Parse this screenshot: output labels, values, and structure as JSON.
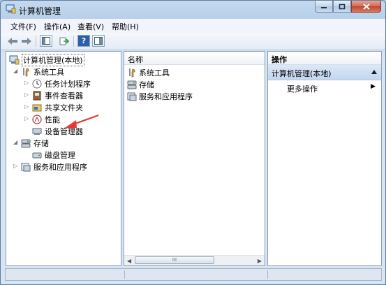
{
  "window": {
    "title": "计算机管理"
  },
  "menu": {
    "items": [
      "文件(F)",
      "操作(A)",
      "查看(V)",
      "帮助(H)"
    ]
  },
  "tree": {
    "root": "计算机管理(本地)",
    "items": [
      {
        "label": "系统工具",
        "icon": "tools-icon"
      },
      {
        "label": "任务计划程序",
        "icon": "clock-icon"
      },
      {
        "label": "事件查看器",
        "icon": "event-viewer-icon"
      },
      {
        "label": "共享文件夹",
        "icon": "shared-folder-icon"
      },
      {
        "label": "性能",
        "icon": "performance-icon"
      },
      {
        "label": "设备管理器",
        "icon": "device-manager-icon"
      },
      {
        "label": "存储",
        "icon": "storage-icon"
      },
      {
        "label": "磁盘管理",
        "icon": "disk-icon"
      },
      {
        "label": "服务和应用程序",
        "icon": "services-icon"
      }
    ]
  },
  "list": {
    "header": "名称",
    "items": [
      {
        "label": "系统工具",
        "icon": "tools-icon"
      },
      {
        "label": "存储",
        "icon": "storage-icon"
      },
      {
        "label": "服务和应用程序",
        "icon": "services-icon"
      }
    ],
    "scroll_grip": "III"
  },
  "actions": {
    "header": "操作",
    "selected": "计算机管理(本地)",
    "more": "更多操作"
  },
  "colors": {
    "accent": "#1f5fb0",
    "annotation_arrow": "#e53935"
  }
}
